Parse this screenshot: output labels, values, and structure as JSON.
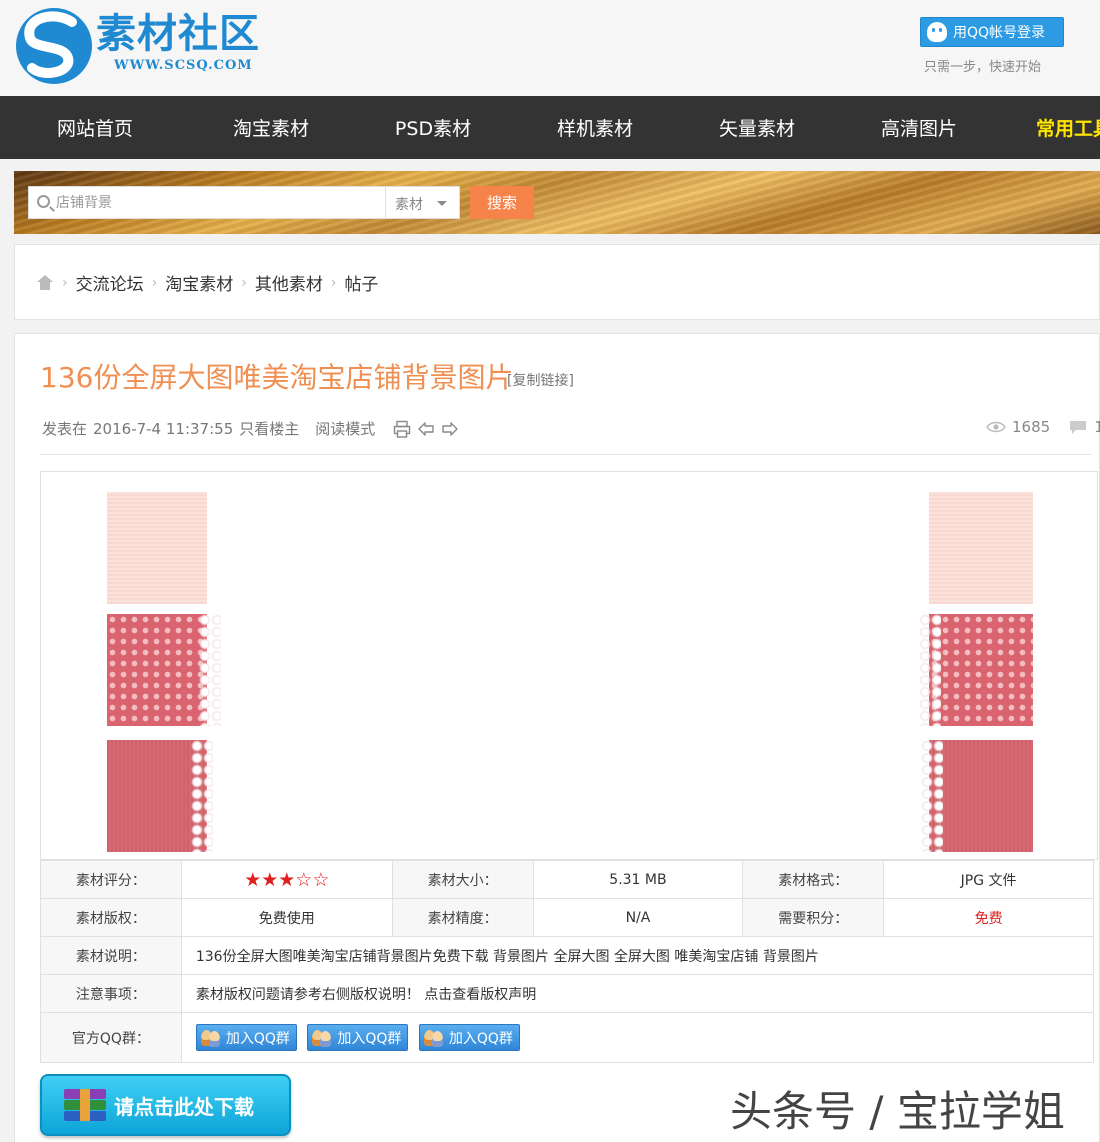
{
  "header": {
    "logo_text": "素材社区",
    "logo_url": "WWW.SCSQ.COM",
    "qq_login_label": "用QQ帐号登录",
    "qq_login_tip": "只需一步，快速开始"
  },
  "nav": {
    "items": [
      "网站首页",
      "淘宝素材",
      "PSD素材",
      "样机素材",
      "矢量素材",
      "高清图片",
      "常用工具"
    ]
  },
  "search": {
    "placeholder": "店铺背景",
    "category": "素材",
    "button": "搜索"
  },
  "breadcrumb": {
    "items": [
      "交流论坛",
      "淘宝素材",
      "其他素材",
      "帖子"
    ]
  },
  "post": {
    "title": "136份全屏大图唯美淘宝店铺背景图片",
    "copy_link": "[复制链接]",
    "posted_prefix": "发表在",
    "posted_at": "2016-7-4 11:37:55",
    "only_op": "只看楼主",
    "read_mode": "阅读模式",
    "views": "1685",
    "replies": "1"
  },
  "info": {
    "rating_label": "素材评分：",
    "rating_value": "★★★☆☆",
    "rating": 3,
    "rating_max": 5,
    "size_label": "素材大小：",
    "size_value": "5.31 MB",
    "format_label": "素材格式：",
    "format_value": "JPG 文件",
    "license_label": "素材版权：",
    "license_value": "免费使用",
    "precision_label": "素材精度：",
    "precision_value": "N/A",
    "points_label": "需要积分：",
    "points_value": "免费",
    "desc_label": "素材说明：",
    "desc_value": "136份全屏大图唯美淘宝店铺背景图片免费下载 背景图片 全屏大图 全屏大图 唯美淘宝店铺 背景图片",
    "notice_label": "注意事项：",
    "notice_value": "素材版权问题请参考右侧版权说明！ 点击查看版权声明",
    "qq_group_label": "官方QQ群：",
    "qq_group_buttons": [
      "加入QQ群",
      "加入QQ群",
      "加入QQ群"
    ]
  },
  "download": {
    "label": "请点击此处下载"
  },
  "watermark": "头条号 / 宝拉学姐",
  "colors": {
    "nav_bg": "#333333",
    "accent_orange": "#ef8f52",
    "search_button": "#f6844a",
    "qq_blue": "#2d9be3",
    "highlight_yellow": "#ffe500",
    "free_red": "#e02020"
  }
}
